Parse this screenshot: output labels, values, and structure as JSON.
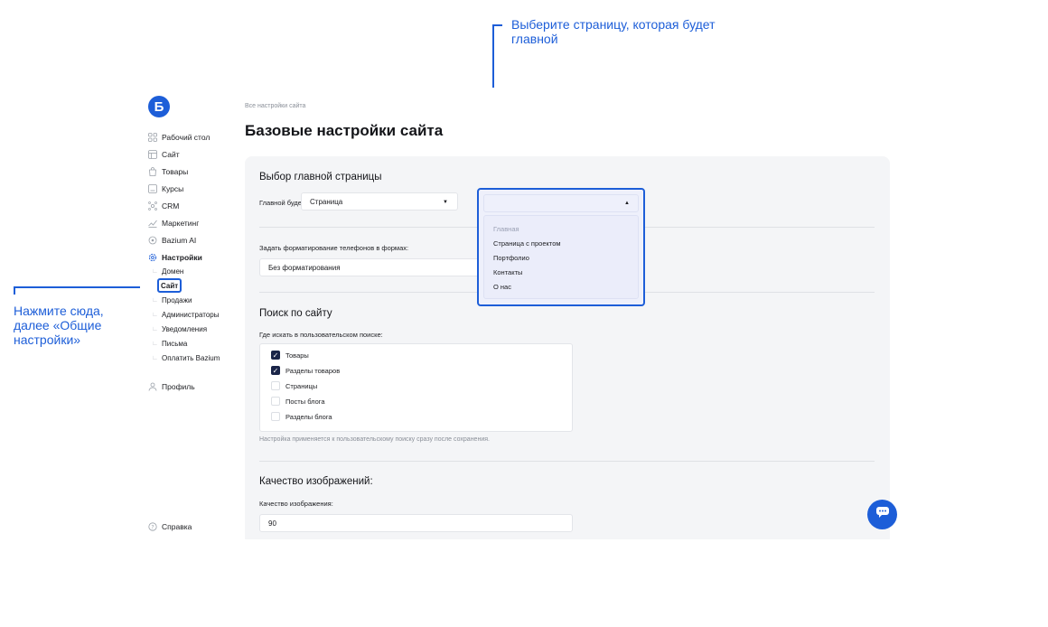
{
  "app": {
    "logo_letter": "Б"
  },
  "sidebar": {
    "items": [
      {
        "label": "Рабочий стол",
        "icon": "dashboard-icon"
      },
      {
        "label": "Сайт",
        "icon": "site-icon"
      },
      {
        "label": "Товары",
        "icon": "bag-icon"
      },
      {
        "label": "Курсы",
        "icon": "courses-icon"
      },
      {
        "label": "CRM",
        "icon": "crm-icon"
      },
      {
        "label": "Маркетинг",
        "icon": "marketing-icon"
      },
      {
        "label": "Bazium AI",
        "icon": "ai-icon"
      },
      {
        "label": "Настройки",
        "icon": "gear-icon"
      }
    ],
    "sub_items": [
      "Домен",
      "Сайт",
      "Продажи",
      "Администраторы",
      "Уведомления",
      "Письма",
      "Оплатить Bazium"
    ],
    "profile": "Профиль",
    "help": "Справка"
  },
  "breadcrumb": "Все настройки сайта",
  "page_title": "Базовые настройки сайта",
  "main_page": {
    "section_title": "Выбор главной страницы",
    "label": "Главной будет",
    "select_value": "Страница",
    "dropdown_options": [
      "Главная",
      "Страница с проектом",
      "Портфолио",
      "Контакты",
      "О нас"
    ]
  },
  "phone_format": {
    "label": "Задать форматирование телефонов в формах:",
    "value": "Без форматирования"
  },
  "search": {
    "section_title": "Поиск по сайту",
    "label": "Где искать в пользовательском поиске:",
    "options": [
      {
        "label": "Товары",
        "checked": true
      },
      {
        "label": "Разделы товаров",
        "checked": true
      },
      {
        "label": "Страницы",
        "checked": false
      },
      {
        "label": "Посты блога",
        "checked": false
      },
      {
        "label": "Разделы блога",
        "checked": false
      }
    ],
    "hint": "Настройка применяется к пользовательскому поиску сразу после сохранения."
  },
  "image_quality": {
    "section_title": "Качество изображений:",
    "label": "Качество изображения:",
    "value": "90"
  },
  "annotations": {
    "top": "Выберите страницу, которая будет главной",
    "left": "Нажмите сюда, далее «Общие настройки»"
  },
  "colors": {
    "accent": "#1d5ed8",
    "checkbox_checked": "#1a2548",
    "panel_bg": "#f4f5f7"
  }
}
